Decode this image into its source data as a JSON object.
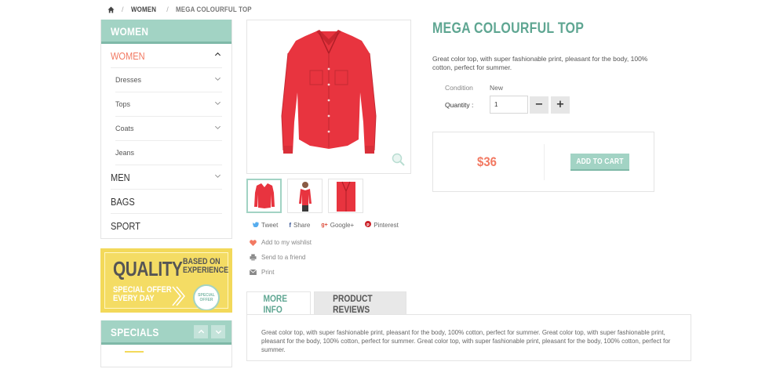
{
  "breadcrumb": {
    "home_icon": "home-icon",
    "items": [
      "WOMEN",
      "MEGA COLOURFUL TOP"
    ]
  },
  "sidebar": {
    "title": "WOMEN",
    "categories": [
      {
        "label": "WOMEN",
        "state": "expanded"
      },
      {
        "label": "Dresses"
      },
      {
        "label": "Tops"
      },
      {
        "label": "Coats"
      },
      {
        "label": "Jeans"
      },
      {
        "label": "MEN"
      },
      {
        "label": "BAGS"
      },
      {
        "label": "SPORT"
      }
    ]
  },
  "quality_banner": {
    "big": "QUALITY",
    "small_line1": "BASED ON",
    "small_line2": "EXPERIENCE",
    "offer_line1": "SPECIAL OFFER",
    "offer_line2": "EVERY DAY",
    "badge_line1": "SPECIAL",
    "badge_line2": "OFFER"
  },
  "specials": {
    "title": "SPECIALS"
  },
  "product": {
    "title": "MEGA COLOURFUL TOP",
    "description": "Great color top, with super fashionable print, pleasant for the body, 100% cotton, perfect for summer.",
    "condition_label": "Condition",
    "condition_value": "New",
    "quantity_label": "Quantity :",
    "quantity_value": "1",
    "minus": "−",
    "plus": "+",
    "price": "$36",
    "add_to_cart": "ADD TO CART"
  },
  "share": {
    "tweet": "Tweet",
    "share": "Share",
    "google": "Google+",
    "pinterest": "Pinterest"
  },
  "actions": {
    "wishlist": "Add to my wishlist",
    "send": "Send to a friend",
    "print": "Print"
  },
  "tabs": {
    "more_info": "MORE INFO",
    "reviews": "PRODUCT REVIEWS",
    "content": "Great color top, with super fashionable print, pleasant for the body, 100% cotton, perfect for summer. Great color top, with super fashionable print, pleasant for the body, 100% cotton, perfect for summer. Great color top, with super fashionable print, pleasant for the body, 100% cotton, perfect for summer."
  },
  "colors": {
    "accent": "#a2d3c4",
    "accent_dark": "#5fa692",
    "price": "#f27962",
    "banner": "#f3d95a"
  }
}
